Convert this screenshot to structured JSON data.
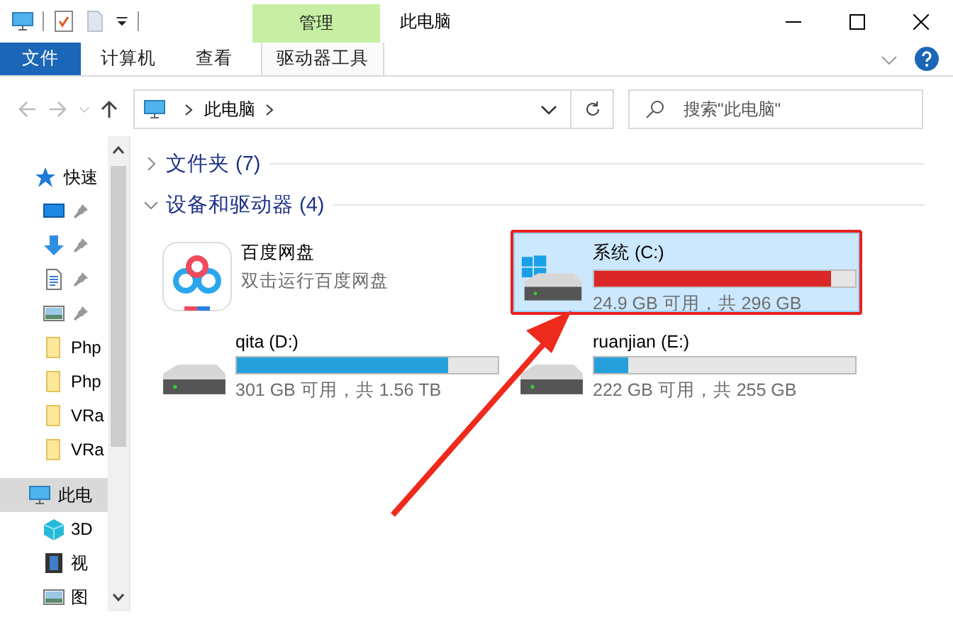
{
  "window": {
    "title": "此电脑",
    "context_group": "管理"
  },
  "ribbon_tabs": [
    {
      "label": "文件",
      "kind": "file",
      "selected": false
    },
    {
      "label": "计算机",
      "kind": "tab",
      "selected": false
    },
    {
      "label": "查看",
      "kind": "tab",
      "selected": false
    },
    {
      "label": "驱动器工具",
      "kind": "context",
      "selected": false
    }
  ],
  "address_bar": {
    "path": [
      "此电脑"
    ]
  },
  "search": {
    "placeholder": "搜索\"此电脑\""
  },
  "sidebar": {
    "items": [
      {
        "label": "快速",
        "kind": "star",
        "selected": false,
        "children": [
          {
            "kind": "desktop",
            "pinned": true,
            "selected": false
          },
          {
            "kind": "download",
            "pinned": true,
            "selected": false
          },
          {
            "kind": "document",
            "pinned": true,
            "selected": false
          },
          {
            "kind": "pictures",
            "pinned": true,
            "selected": false
          },
          {
            "label": "Php",
            "kind": "folder",
            "pinned": false,
            "selected": false
          },
          {
            "label": "Php",
            "kind": "folder",
            "pinned": false,
            "selected": false
          },
          {
            "label": "VRa",
            "kind": "folder",
            "pinned": false,
            "selected": false
          },
          {
            "label": "VRa",
            "kind": "folder",
            "pinned": false,
            "selected": false
          }
        ]
      },
      {
        "label": "此电",
        "kind": "pc",
        "selected": true,
        "children": [
          {
            "label": "3D",
            "kind": "cube",
            "pinned": false,
            "selected": false
          },
          {
            "label": "视",
            "kind": "video",
            "pinned": false,
            "selected": false
          },
          {
            "label": "图",
            "kind": "pictures",
            "pinned": false,
            "selected": false
          }
        ]
      }
    ]
  },
  "sections": [
    {
      "title": "文件夹 (7)",
      "expanded": false
    },
    {
      "title": "设备和驱动器 (4)",
      "expanded": true,
      "items": [
        {
          "kind": "app",
          "name": "百度网盘",
          "subtitle": "双击运行百度网盘",
          "selected": false,
          "highlighted": false
        },
        {
          "kind": "system_drive",
          "name": "系统 (C:)",
          "level": 0.91,
          "usage": "24.9 GB 可用，共 296 GB",
          "low_space": true,
          "selected": true,
          "highlighted": true
        },
        {
          "kind": "drive",
          "name": "qita (D:)",
          "level": 0.81,
          "usage": "301 GB 可用，共 1.56 TB",
          "low_space": false,
          "selected": false,
          "highlighted": false
        },
        {
          "kind": "drive",
          "name": "ruanjian (E:)",
          "level": 0.13,
          "usage": "222 GB 可用，共 255 GB",
          "low_space": false,
          "selected": false,
          "highlighted": false
        }
      ]
    }
  ]
}
